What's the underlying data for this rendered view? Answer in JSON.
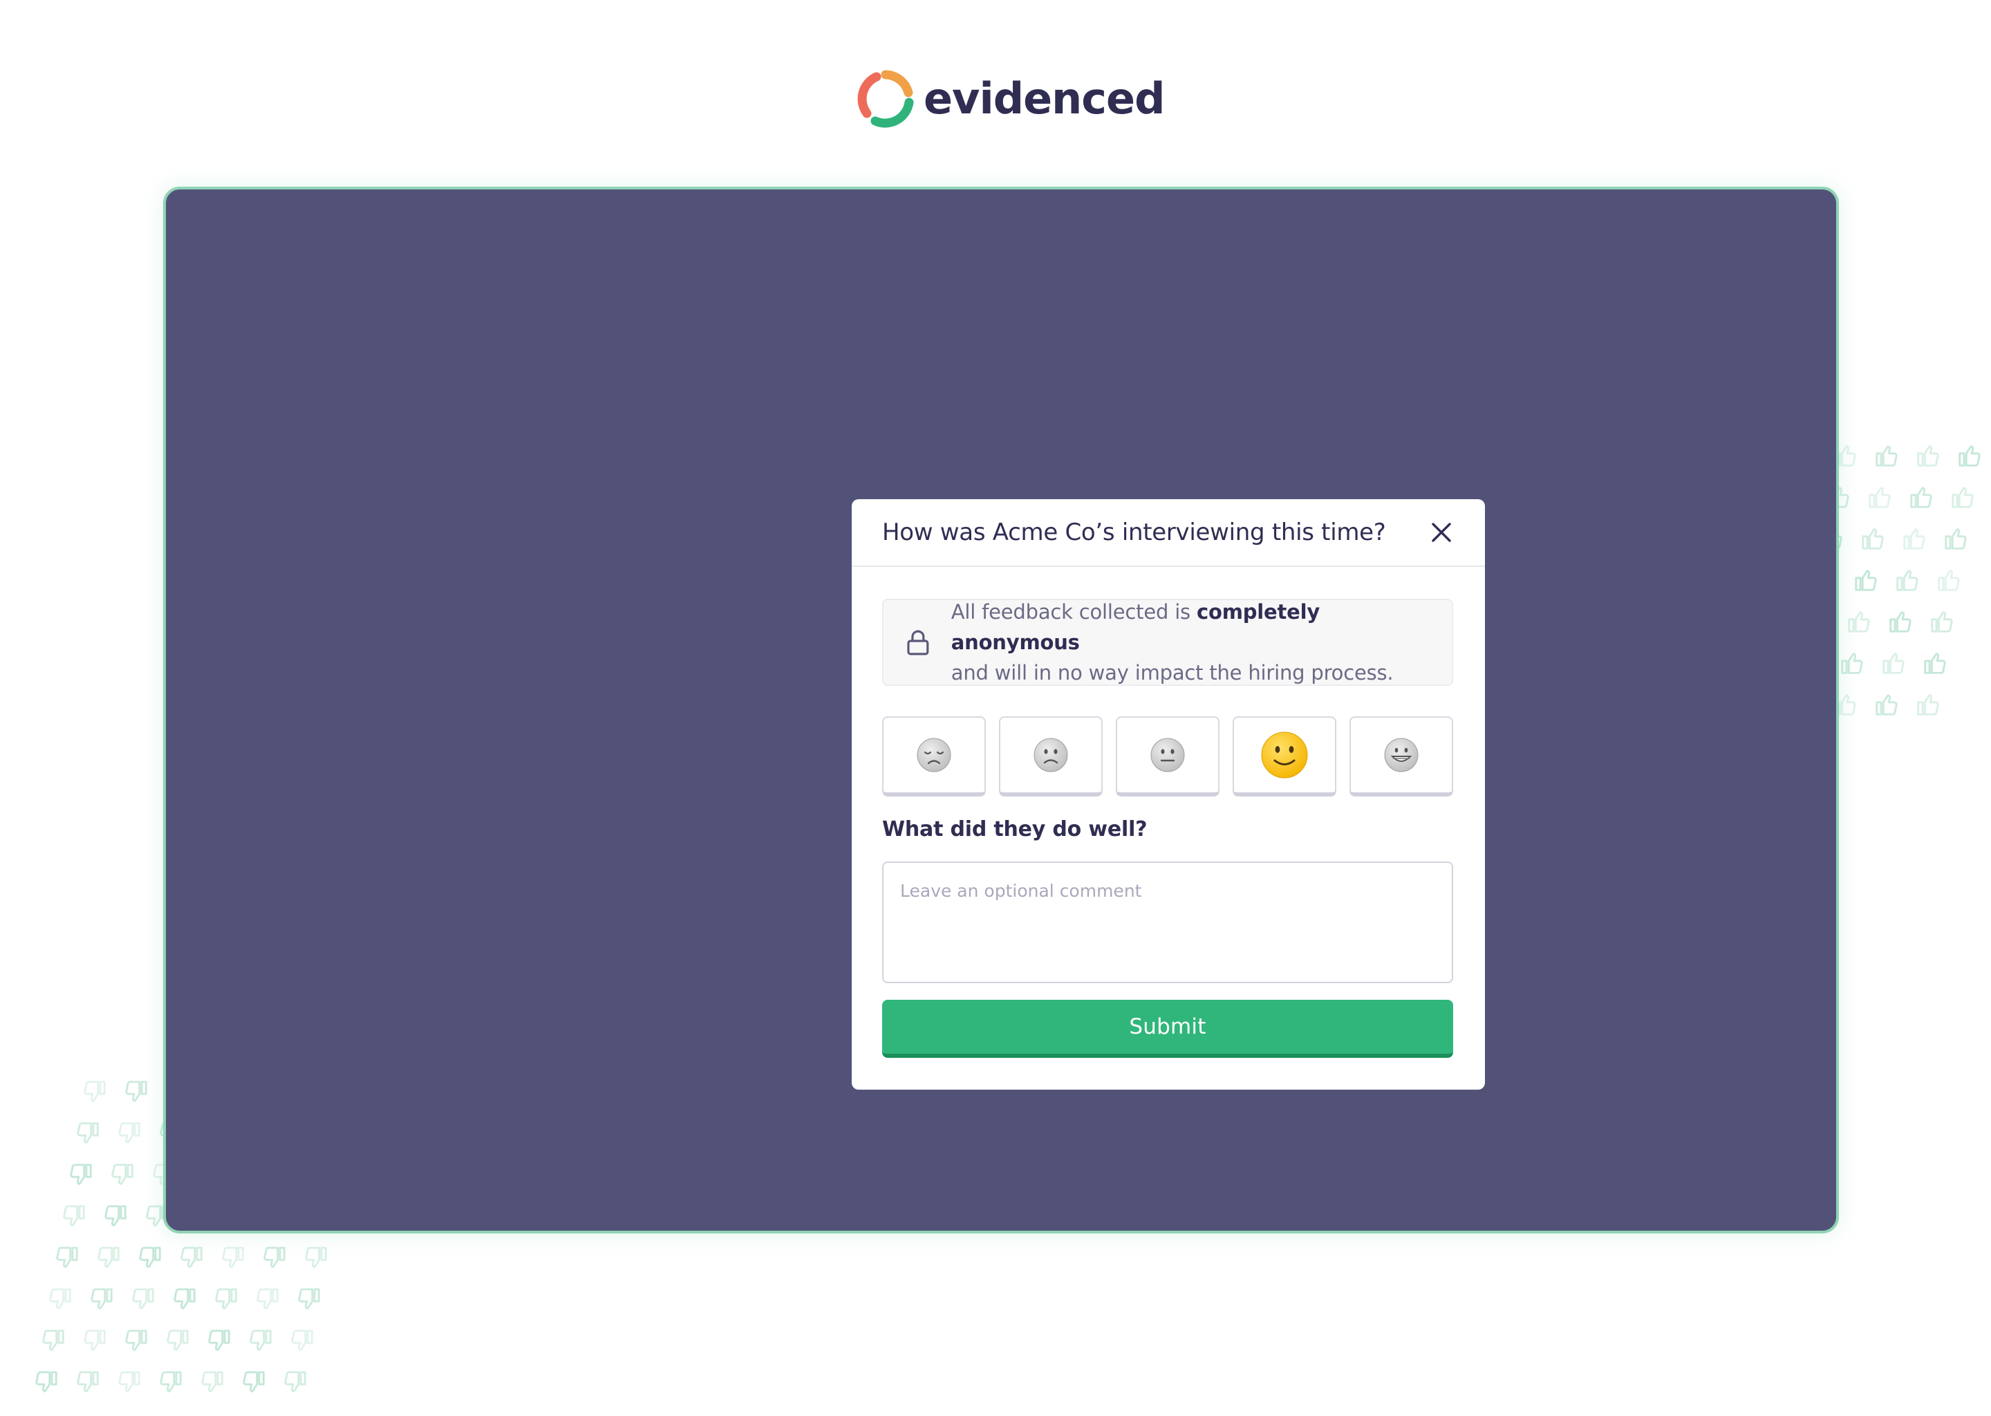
{
  "logo": {
    "text": "evidenced"
  },
  "modal": {
    "title": "How was Acme Co’s interviewing this time?",
    "notice": {
      "text_before": "All feedback collected is ",
      "text_bold": "completely anonymous",
      "text_after": " and will in no way impact the hiring process."
    },
    "ratings": [
      {
        "emoji": "disappointed-face",
        "selected": false
      },
      {
        "emoji": "slightly-frowning-face",
        "selected": false
      },
      {
        "emoji": "neutral-face",
        "selected": false
      },
      {
        "emoji": "slightly-smiling-face",
        "selected": true
      },
      {
        "emoji": "grinning-face",
        "selected": false
      }
    ],
    "question": "What did they do well?",
    "comment": {
      "value": "",
      "placeholder": "Leave an optional comment"
    },
    "submit_label": "Submit"
  },
  "colors": {
    "frame_background": "#525279",
    "frame_border": "#8fd4b4",
    "brand_dark": "#2f2d52",
    "submit_green": "#30b67b",
    "selected_emoji": "#fcc21b"
  }
}
